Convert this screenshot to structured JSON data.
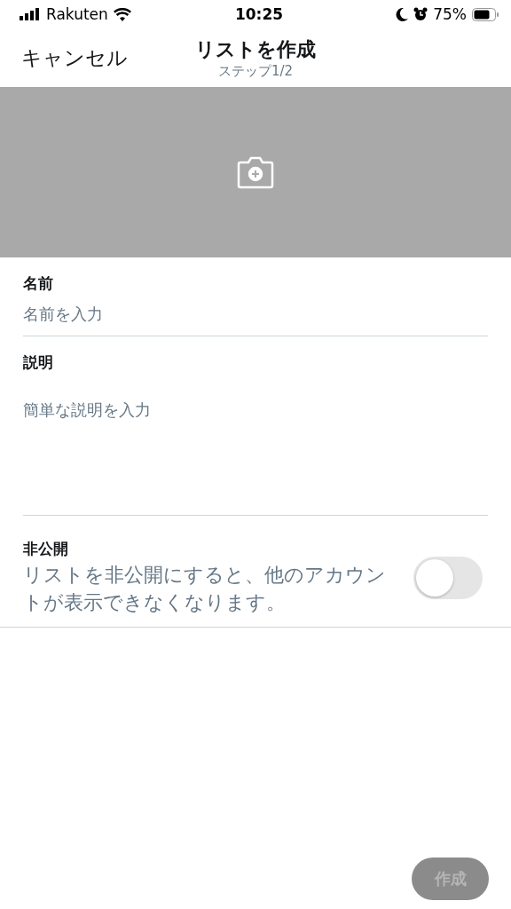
{
  "status_bar": {
    "carrier": "Rakuten",
    "time": "10:25",
    "battery": "75%"
  },
  "header": {
    "cancel": "キャンセル",
    "title": "リストを作成",
    "subtitle": "ステップ1/2"
  },
  "cover": {
    "kind": "empty"
  },
  "fields": [
    {
      "label": "名前",
      "placeholder": "名前を入力",
      "kind": "single"
    },
    {
      "label": "説明",
      "placeholder": "簡単な説明を入力",
      "kind": "multi"
    }
  ],
  "private": {
    "label": "非公開",
    "description": "リストを非公開にすると、他のアカウントが表示できなくなります。",
    "on": false
  },
  "create_button": {
    "label": "作成",
    "disabled": true
  }
}
